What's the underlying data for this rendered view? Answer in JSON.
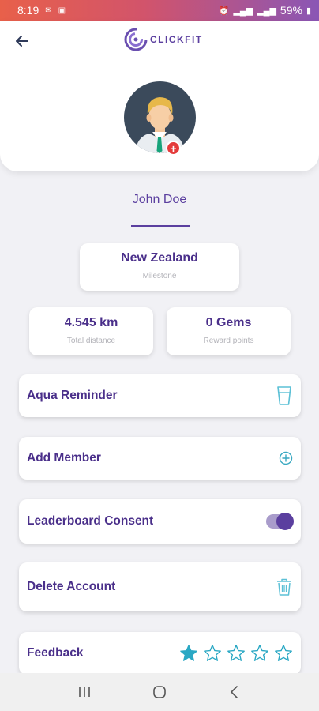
{
  "status_bar": {
    "time": "8:19",
    "battery": "59%"
  },
  "header": {
    "logo_text": "CLICKFIT"
  },
  "user": {
    "name": "John Doe"
  },
  "milestone": {
    "value": "New Zealand",
    "label": "Milestone"
  },
  "distance": {
    "value": "4.545 km",
    "label": "Total distance"
  },
  "gems": {
    "value": "0 Gems",
    "label": "Reward points"
  },
  "rows": {
    "aqua": "Aqua Reminder",
    "add_member": "Add Member",
    "leaderboard": "Leaderboard Consent",
    "delete": "Delete Account",
    "feedback": "Feedback"
  },
  "leaderboard_consent_enabled": true,
  "feedback_rating": {
    "value": 1,
    "max": 5
  },
  "colors": {
    "primary": "#5b3f9f",
    "accent": "#2aa8c4",
    "danger": "#e43b3b"
  },
  "icons": [
    "back-arrow-icon",
    "glass-icon",
    "add-circle-icon",
    "trash-icon",
    "star-icon",
    "recent-apps-icon",
    "home-icon",
    "nav-back-icon"
  ]
}
